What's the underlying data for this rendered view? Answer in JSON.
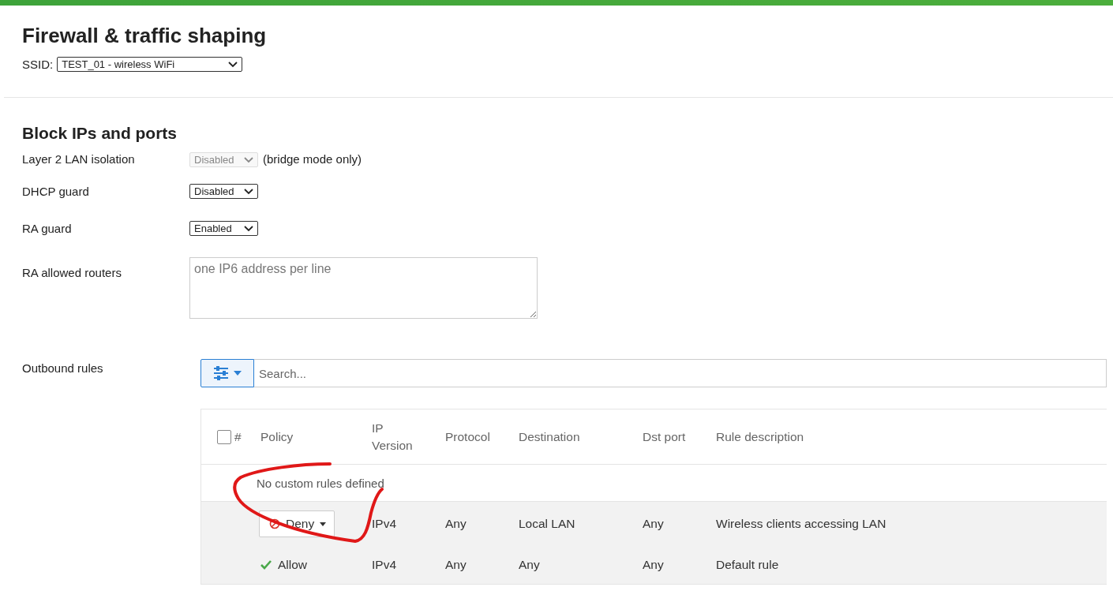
{
  "page_title": "Firewall & traffic shaping",
  "ssid": {
    "label": "SSID:",
    "value": "TEST_01 - wireless WiFi"
  },
  "section_title": "Block IPs and ports",
  "settings": [
    {
      "kind": "select",
      "label": "Layer 2 LAN isolation",
      "value": "Disabled",
      "disabled": true,
      "note": "(bridge mode only)"
    },
    {
      "kind": "select",
      "label": "DHCP guard",
      "value": "Disabled",
      "disabled": false
    },
    {
      "kind": "select",
      "label": "RA guard",
      "value": "Enabled",
      "disabled": false
    },
    {
      "kind": "textarea",
      "label": "RA allowed routers",
      "placeholder": "one IP6 address per line"
    }
  ],
  "outbound": {
    "label": "Outbound rules",
    "search_placeholder": "Search...",
    "select_all_checked": false,
    "columns": [
      "#",
      "Policy",
      "IP Version",
      "Protocol",
      "Destination",
      "Dst port",
      "Rule description"
    ],
    "empty_message": "No custom rules defined",
    "rows": [
      {
        "kind": "deny",
        "policy": "Deny",
        "ip_version": "IPv4",
        "protocol": "Any",
        "destination": "Local LAN",
        "dst_port": "Any",
        "description": "Wireless clients accessing LAN"
      },
      {
        "kind": "allow",
        "policy": "Allow",
        "ip_version": "IPv4",
        "protocol": "Any",
        "destination": "Any",
        "dst_port": "Any",
        "description": "Default rule"
      }
    ]
  }
}
